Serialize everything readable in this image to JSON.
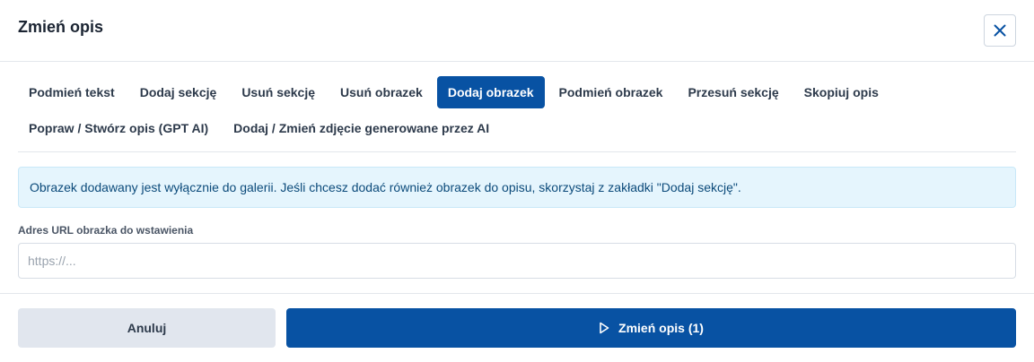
{
  "dialog": {
    "title": "Zmień opis",
    "close_icon": "close-icon"
  },
  "tabs": {
    "row1": [
      {
        "label": "Podmień tekst",
        "active": false
      },
      {
        "label": "Dodaj sekcję",
        "active": false
      },
      {
        "label": "Usuń sekcję",
        "active": false
      },
      {
        "label": "Usuń obrazek",
        "active": false
      },
      {
        "label": "Dodaj obrazek",
        "active": true
      },
      {
        "label": "Podmień obrazek",
        "active": false
      },
      {
        "label": "Przesuń sekcję",
        "active": false
      },
      {
        "label": "Skopiuj opis",
        "active": false
      }
    ],
    "row2": [
      {
        "label": "Popraw / Stwórz opis (GPT AI)",
        "active": false
      },
      {
        "label": "Dodaj / Zmień zdjęcie generowane przez AI",
        "active": false
      }
    ]
  },
  "info": {
    "message": "Obrazek dodawany jest wyłącznie do galerii. Jeśli chcesz dodać również obrazek do opisu, skorzystaj z zakładki \"Dodaj sekcję\"."
  },
  "url_field": {
    "label": "Adres URL obrazka do wstawienia",
    "value": "",
    "placeholder": "https://..."
  },
  "footer": {
    "cancel_label": "Anuluj",
    "submit_label": "Zmień opis (1)",
    "submit_icon": "play-icon"
  },
  "colors": {
    "accent": "#0852a3",
    "info_bg": "#e5f5fd",
    "info_text": "#0b4a7a",
    "cancel_bg": "#e1e6ee"
  }
}
